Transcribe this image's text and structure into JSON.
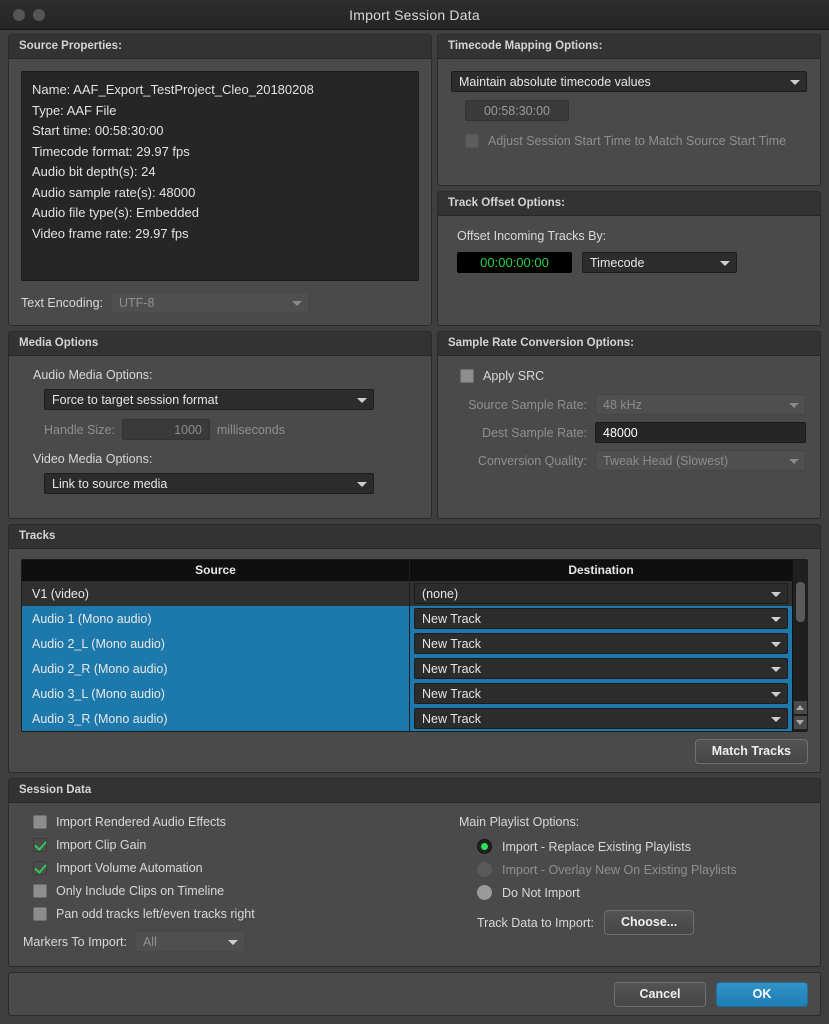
{
  "window": {
    "title": "Import Session Data"
  },
  "source_properties": {
    "header": "Source Properties:",
    "lines": [
      "Name: AAF_Export_TestProject_Cleo_20180208",
      "Type: AAF File",
      "Start time: 00:58:30:00",
      "Timecode format: 29.97 fps",
      "Audio bit depth(s): 24",
      "Audio sample rate(s): 48000",
      "Audio file type(s): Embedded",
      "Video frame rate: 29.97 fps"
    ],
    "text_encoding_label": "Text Encoding:",
    "text_encoding_value": "UTF-8"
  },
  "timecode_mapping": {
    "header": "Timecode Mapping Options:",
    "mode_value": "Maintain absolute timecode values",
    "timecode_value": "00:58:30:00",
    "adjust_checkbox_label": "Adjust Session Start Time to Match Source Start Time",
    "adjust_checked": false
  },
  "track_offset": {
    "header": "Track Offset Options:",
    "label": "Offset Incoming Tracks By:",
    "value": "00:00:00:00",
    "unit_value": "Timecode"
  },
  "media_options": {
    "header": "Media Options",
    "audio_label": "Audio Media Options:",
    "audio_value": "Force to target session format",
    "handle_label": "Handle Size:",
    "handle_value": "1000",
    "handle_unit": "milliseconds",
    "video_label": "Video Media Options:",
    "video_value": "Link to source media"
  },
  "sample_rate": {
    "header": "Sample Rate Conversion Options:",
    "apply_src_label": "Apply SRC",
    "apply_src_checked": false,
    "source_rate_label": "Source Sample Rate:",
    "source_rate_value": "48 kHz",
    "dest_rate_label": "Dest Sample Rate:",
    "dest_rate_value": "48000",
    "quality_label": "Conversion Quality:",
    "quality_value": "Tweak Head (Slowest)"
  },
  "tracks": {
    "header": "Tracks",
    "columns": {
      "source": "Source",
      "destination": "Destination"
    },
    "rows": [
      {
        "source": "V1 (video)",
        "destination": "(none)",
        "selected": false
      },
      {
        "source": "Audio 1 (Mono audio)",
        "destination": "New Track",
        "selected": true
      },
      {
        "source": "Audio 2_L (Mono audio)",
        "destination": "New Track",
        "selected": true
      },
      {
        "source": "Audio 2_R (Mono audio)",
        "destination": "New Track",
        "selected": true
      },
      {
        "source": "Audio 3_L (Mono audio)",
        "destination": "New Track",
        "selected": true
      },
      {
        "source": "Audio 3_R (Mono audio)",
        "destination": "New Track",
        "selected": true
      }
    ],
    "match_tracks_label": "Match Tracks"
  },
  "session_data": {
    "header": "Session Data",
    "checkboxes": [
      {
        "label": "Import Rendered Audio Effects",
        "checked": false
      },
      {
        "label": "Import Clip Gain",
        "checked": true
      },
      {
        "label": "Import Volume Automation",
        "checked": true
      },
      {
        "label": "Only Include Clips on Timeline",
        "checked": false
      },
      {
        "label": "Pan odd tracks left/even tracks right",
        "checked": false
      }
    ],
    "markers_label": "Markers To Import:",
    "markers_value": "All",
    "playlist_header": "Main Playlist Options:",
    "playlist_options": [
      {
        "label": "Import - Replace Existing Playlists",
        "selected": true,
        "disabled": false
      },
      {
        "label": "Import - Overlay New On Existing Playlists",
        "selected": false,
        "disabled": true
      },
      {
        "label": "Do Not Import",
        "selected": false,
        "disabled": false
      }
    ],
    "track_data_label": "Track Data to Import:",
    "choose_label": "Choose..."
  },
  "footer": {
    "cancel_label": "Cancel",
    "ok_label": "OK"
  },
  "colors": {
    "accent": "#1d79ab",
    "check_green": "#2ecc55",
    "timecode_green": "#25d04a"
  }
}
